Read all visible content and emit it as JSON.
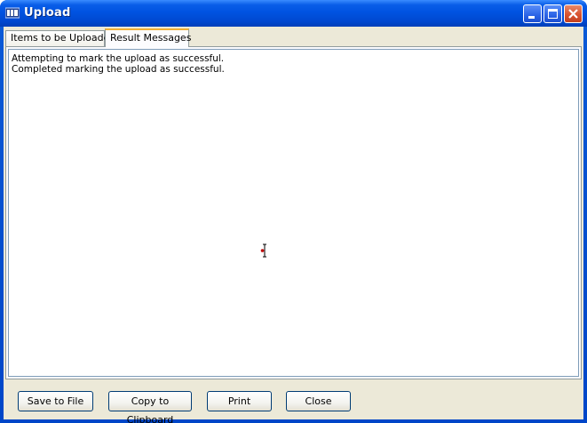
{
  "window": {
    "title": "Upload"
  },
  "tabs": [
    {
      "label": "Items to be Uploaded",
      "active": false
    },
    {
      "label": "Result Messages",
      "active": true
    }
  ],
  "messages": [
    "Attempting to mark the upload as successful.",
    "Completed marking the upload as successful."
  ],
  "buttons": {
    "save": "Save to File",
    "copy": "Copy to Clipboard",
    "print": "Print",
    "close": "Close"
  },
  "icons": {
    "app": "upload-app-icon",
    "minimize": "minimize-icon",
    "maximize": "maximize-icon",
    "close": "close-icon",
    "cursor": "text-cursor-icon"
  },
  "colors": {
    "titlebar": "#0053e1",
    "client_bg": "#ece9d8",
    "tab_accent": "#f2b134",
    "close_button": "#d9532f"
  }
}
